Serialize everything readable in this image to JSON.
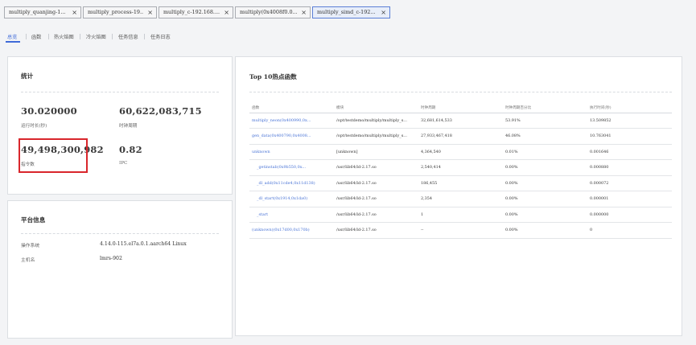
{
  "tabs": [
    {
      "label": "multiply_quanjing-1...",
      "close": "×"
    },
    {
      "label": "multiply_process-19...",
      "close": "×"
    },
    {
      "label": "multiply_c-192.168....",
      "close": "×"
    },
    {
      "label": "multiply(0x4008f0.0...",
      "close": "×"
    },
    {
      "label": "multiply_simd_c-192...",
      "close": "×"
    }
  ],
  "subtabs": [
    "总览",
    "函数",
    "热火焰图",
    "冷火焰图",
    "任务信息",
    "任务日志"
  ],
  "stats": {
    "title": "统计",
    "runtime_value": "30.020000",
    "runtime_label": "运行时长(秒)",
    "cycles_value": "60,622,083,715",
    "cycles_label": "时钟周期",
    "instr_value": "49,498,300,982",
    "instr_label": "指令数",
    "ipc_value": "0.82",
    "ipc_label": "IPC"
  },
  "platform": {
    "title": "平台信息",
    "os_label": "操作系统",
    "os_value": "4.14.0-115.el7a.0.1.aarch64 Linux",
    "host_label": "主机名",
    "host_value": "lmrs-902"
  },
  "hot": {
    "title": "Top 10热点函数",
    "headers": [
      "函数",
      "模块",
      "时钟周期",
      "时钟周期百分比",
      "执行时间(秒)"
    ],
    "rows": [
      {
        "func": "multiply_neon(0x400990,0x...",
        "module": "/opt/testdemo/multiply/multiply_s...",
        "cycles": "32,681,614,533",
        "pct": "53.91%",
        "time": "13.509852",
        "indent": false
      },
      {
        "func": "gen_data(0x400790,0x4008...",
        "module": "/opt/testdemo/multiply/multiply_s...",
        "cycles": "27,933,467,418",
        "pct": "46.08%",
        "time": "10.763041",
        "indent": false
      },
      {
        "func": "unknown",
        "module": "[unknown]",
        "cycles": "4,364,540",
        "pct": "0.01%",
        "time": "0.001646",
        "indent": false
      },
      {
        "func": "_getinstab(0x9b550,0x...",
        "module": "/usr/lib64/ld-2.17.so",
        "cycles": "2,540,414",
        "pct": "0.00%",
        "time": "0.000880",
        "indent": true
      },
      {
        "func": "_dl_add(0x11cde4,0x11d138)",
        "module": "/usr/lib64/ld-2.17.so",
        "cycles": "186,455",
        "pct": "0.00%",
        "time": "0.000072",
        "indent": true
      },
      {
        "func": "_dl_start(0x1914,0x1da0)",
        "module": "/usr/lib64/ld-2.17.so",
        "cycles": "2,354",
        "pct": "0.00%",
        "time": "0.000001",
        "indent": true
      },
      {
        "func": "_start",
        "module": "/usr/lib64/ld-2.17.so",
        "cycles": "1",
        "pct": "0.00%",
        "time": "0.000000",
        "indent": true
      },
      {
        "func": "(unknown)(0x17d00,0x170b)",
        "module": "/usr/lib64/ld-2.17.so",
        "cycles": "--",
        "pct": "0.00%",
        "time": "0",
        "indent": false
      }
    ]
  }
}
